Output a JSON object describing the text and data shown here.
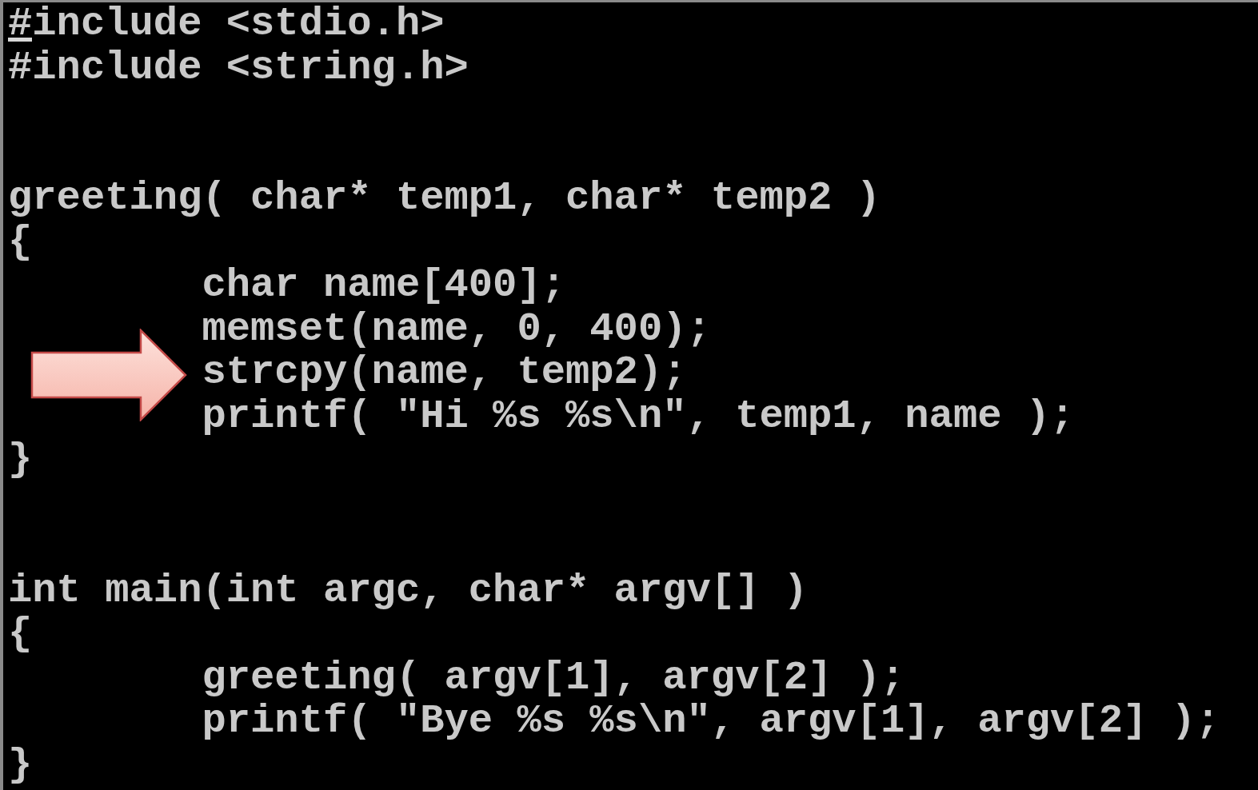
{
  "terminal": {
    "blocks": [
      {
        "lines": [
          {
            "text": "#include <stdio.h>",
            "indented": false,
            "cursor": true,
            "marked": false
          },
          {
            "text": "#include <string.h>",
            "indented": false,
            "cursor": false,
            "marked": false
          }
        ]
      },
      {
        "lines": [
          {
            "text": "greeting( char* temp1, char* temp2 )",
            "indented": false,
            "cursor": false,
            "marked": false
          },
          {
            "text": "{",
            "indented": false,
            "cursor": false,
            "marked": false
          },
          {
            "text": "char name[400];",
            "indented": true,
            "cursor": false,
            "marked": false
          },
          {
            "text": "memset(name, 0, 400);",
            "indented": true,
            "cursor": false,
            "marked": false
          },
          {
            "text": "strcpy(name, temp2);",
            "indented": true,
            "cursor": false,
            "marked": true
          },
          {
            "text": "printf( \"Hi %s %s\\n\", temp1, name );",
            "indented": true,
            "cursor": false,
            "marked": false
          },
          {
            "text": "}",
            "indented": false,
            "cursor": false,
            "marked": false
          }
        ]
      },
      {
        "lines": [
          {
            "text": "int main(int argc, char* argv[] )",
            "indented": false,
            "cursor": false,
            "marked": false
          },
          {
            "text": "{",
            "indented": false,
            "cursor": false,
            "marked": false
          },
          {
            "text": "greeting( argv[1], argv[2] );",
            "indented": true,
            "cursor": false,
            "marked": false
          },
          {
            "text": "printf( \"Bye %s %s\\n\", argv[1], argv[2] );",
            "indented": true,
            "cursor": false,
            "marked": false
          },
          {
            "text": "}",
            "indented": false,
            "cursor": false,
            "marked": false
          }
        ]
      }
    ]
  }
}
